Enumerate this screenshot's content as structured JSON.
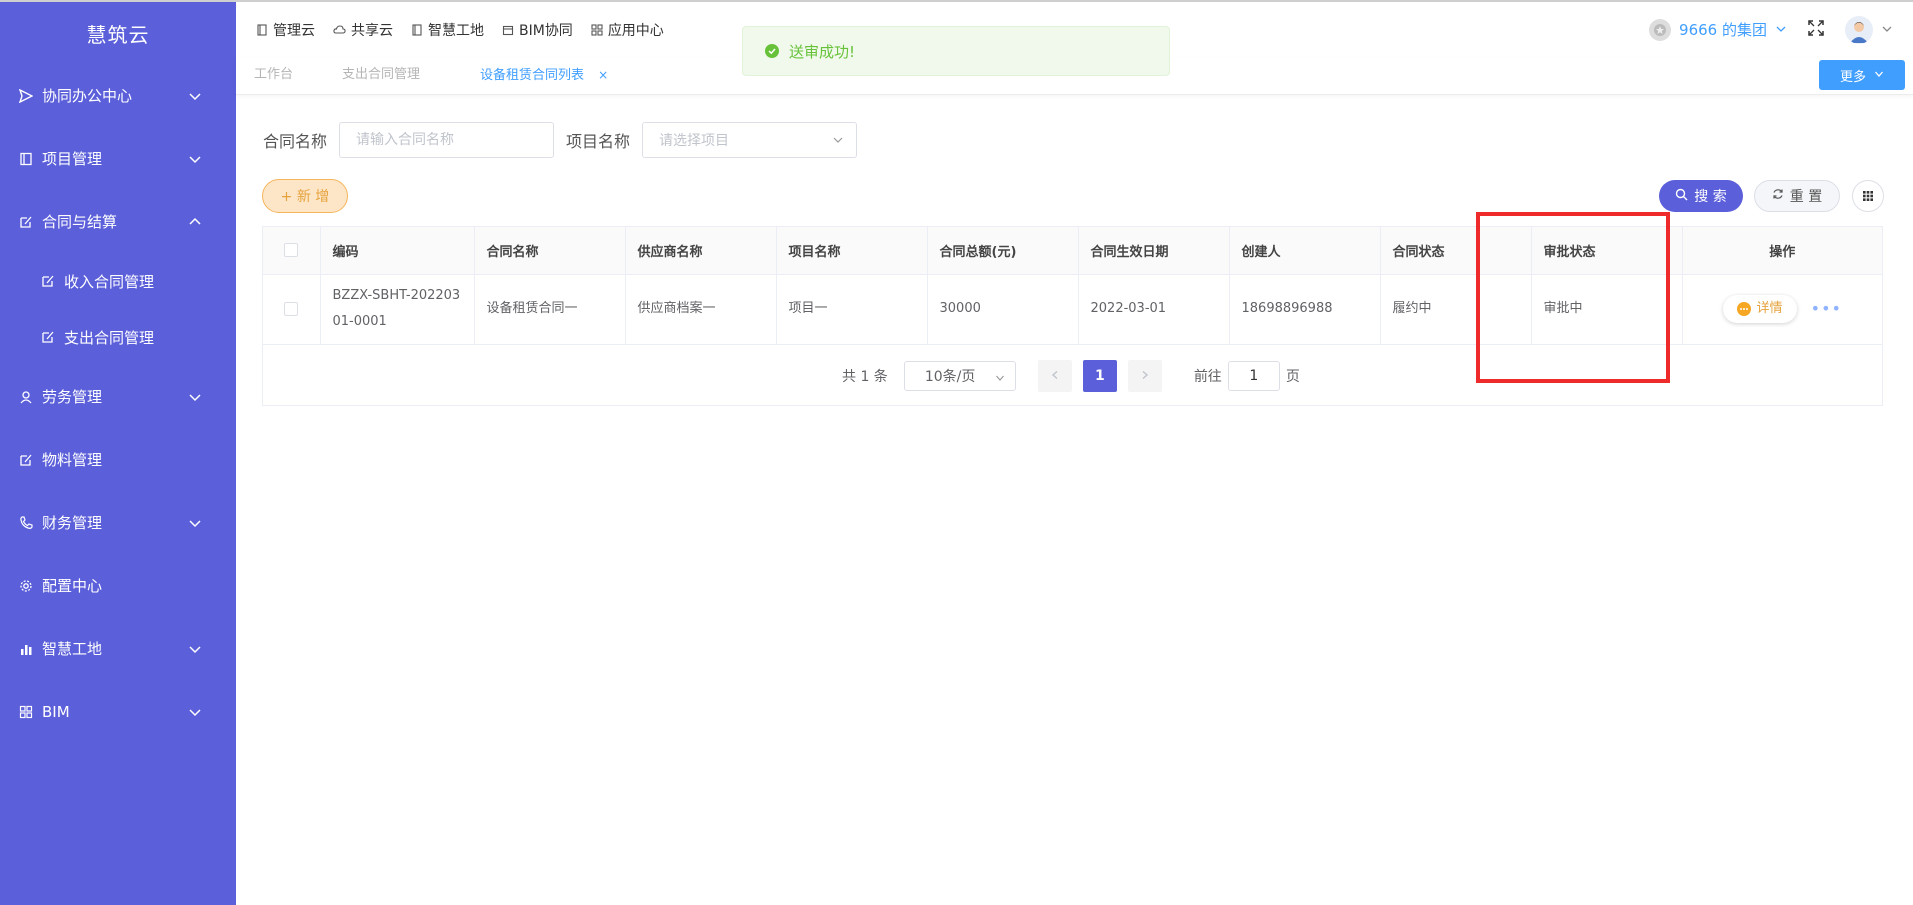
{
  "sidebar": {
    "brand": "慧筑云",
    "items": [
      {
        "label": "协同办公中心"
      },
      {
        "label": "项目管理"
      },
      {
        "label": "合同与结算"
      },
      {
        "label": "收入合同管理"
      },
      {
        "label": "支出合同管理"
      },
      {
        "label": "劳务管理"
      },
      {
        "label": "物料管理"
      },
      {
        "label": "财务管理"
      },
      {
        "label": "配置中心"
      },
      {
        "label": "智慧工地"
      },
      {
        "label": "BIM"
      }
    ]
  },
  "topbar": {
    "menu": [
      {
        "label": "管理云"
      },
      {
        "label": "共享云"
      },
      {
        "label": "智慧工地"
      },
      {
        "label": "BIM协同"
      },
      {
        "label": "应用中心"
      }
    ],
    "org_name": "9666 的集团"
  },
  "tabs": [
    {
      "label": "工作台"
    },
    {
      "label": "支出合同管理"
    },
    {
      "label": "设备租赁合同列表",
      "close": "×"
    }
  ],
  "more_button": "更多",
  "toast": {
    "message": "送审成功!"
  },
  "filters": {
    "contract_name_label": "合同名称",
    "contract_name_placeholder": "请输入合同名称",
    "project_name_label": "项目名称",
    "project_name_placeholder": "请选择项目"
  },
  "actions": {
    "add": "+ 新 增",
    "search": "搜 索",
    "reset": "重 置"
  },
  "table": {
    "columns": [
      "编码",
      "合同名称",
      "供应商名称",
      "项目名称",
      "合同总额(元)",
      "合同生效日期",
      "创建人",
      "合同状态",
      "审批状态",
      "操作"
    ],
    "rows": [
      {
        "code": "BZZX-SBHT-20220301-0001",
        "contract_name": "设备租赁合同一",
        "supplier": "供应商档案一",
        "project": "项目一",
        "amount": "30000",
        "effective_date": "2022-03-01",
        "creator": "18698896988",
        "contract_status": "履约中",
        "approval_status": "审批中",
        "detail_label": "详情",
        "more": "•••"
      }
    ]
  },
  "pagination": {
    "total": "共 1 条",
    "page_size": "10条/页",
    "current_page": "1",
    "goto_label": "前往",
    "goto_value": "1",
    "page_suffix": "页"
  },
  "colors": {
    "sidebar_bg": "#5b5fd9",
    "primary": "#409eff",
    "success": "#67c23a",
    "warning": "#e6a23c",
    "highlight": "#ee2a2a"
  }
}
